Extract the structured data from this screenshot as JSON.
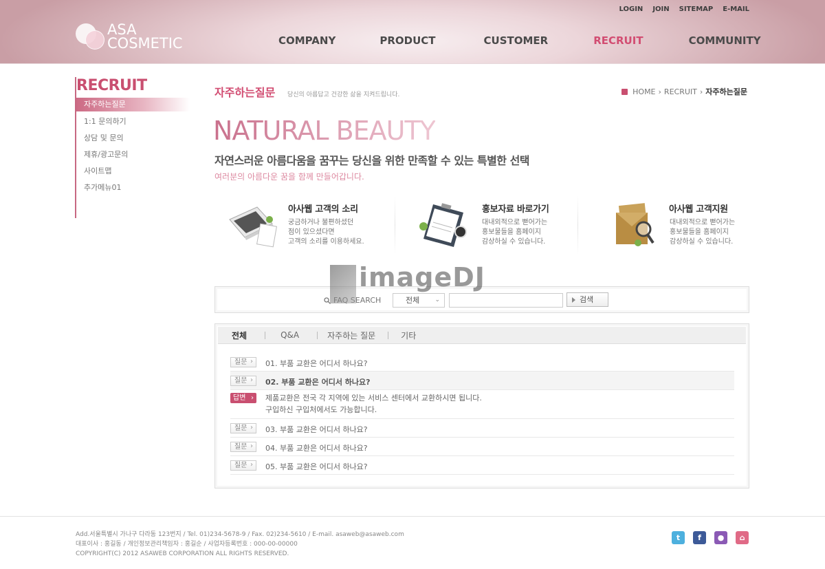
{
  "header": {
    "logo_line1": "ASA",
    "logo_line2": "COSMETIC",
    "util": [
      "LOGIN",
      "JOIN",
      "SITEMAP",
      "E-MAIL"
    ],
    "nav": [
      "COMPANY",
      "PRODUCT",
      "CUSTOMER",
      "RECRUIT",
      "COMMUNITY"
    ],
    "active_nav": "RECRUIT"
  },
  "sidebar": {
    "title": "RECRUIT",
    "items": [
      "자주하는질문",
      "1:1 문의하기",
      "상담 및 문의",
      "제휴/광고문의",
      "사이트맵",
      "추가메뉴01"
    ]
  },
  "page": {
    "title": "자주하는질문",
    "desc": "당신의 아름답고 건강한 삶을 지켜드립니다.",
    "breadcrumb": [
      "HOME",
      "RECRUIT",
      "자주하는질문"
    ]
  },
  "hero": {
    "title": "NATURAL BEAUTY",
    "sub": "자연스러운 아름다움을 꿈꾸는 당신을 위한 만족할 수 있는 특별한 선택",
    "sub2": "여러분의 아름다운 꿈을 함께 만들어갑니다."
  },
  "cards": [
    {
      "title": "아사웹 고객의 소리",
      "text": "궁금하거나 불편하셨던\n점이 있으셨다면\n고객의 소리를 이용하세요."
    },
    {
      "title": "홍보자료 바로가기",
      "text": "대내외적으로 뻗어가는\n홍보물들을 홈페이지\n감상하실 수 있습니다."
    },
    {
      "title": "아사웹 고객지원",
      "text": "대내외적으로 뻗어가는\n홍보물들을 홈페이지\n감상하실 수 있습니다."
    }
  ],
  "search": {
    "label": "FAQ SEARCH",
    "select_value": "전체",
    "input_value": "",
    "button": "검색"
  },
  "watermark": "imageDJ",
  "faq": {
    "tabs": [
      "전체",
      "Q&A",
      "자주하는 질문",
      "기타"
    ],
    "question_badge": "질문",
    "answer_badge": "답변",
    "items": [
      "01. 부품 교환은 어디서 하나요?",
      "02. 부품 교환은 어디서 하나요?",
      "03. 부품 교환은 어디서 하나요?",
      "04. 부품 교환은 어디서 하나요?",
      "05. 부품 교환은 어디서 하나요?"
    ],
    "answer": "제품교환은 전국 각 지역에 있는 서비스 센터에서 교환하시면 됩니다.\n구입하신 구입처에서도 가능합니다."
  },
  "footer": {
    "line1": "Add.서울특별시 가나구 다라동 123번지  / Tel. 01)234-5678-9  / Fax. 02)234-5610  / E-mail. asaweb@asaweb.com",
    "line2": "대표이사 : 홍길동 / 개인정보관리책임자 : 홍길순 / 사업자등록번호 : 000-00-00000",
    "line3": "COPYRIGHT(C) 2012 ASAWEB CORPORATION ALL RIGHTS RESERVED.",
    "sns": [
      "twitter-icon",
      "facebook-icon",
      "blog-icon",
      "home-icon"
    ]
  },
  "colors": {
    "accent": "#c94f70",
    "nav_active": "#d24d72"
  }
}
